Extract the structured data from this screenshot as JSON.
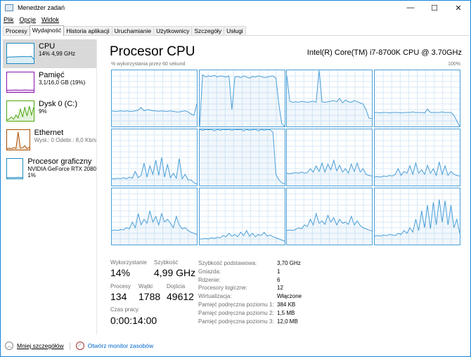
{
  "window": {
    "title": "Menedżer zadań",
    "minimize": "—",
    "maximize": "☐",
    "close": "✕"
  },
  "menu": [
    "Plik",
    "Opcje",
    "Widok"
  ],
  "tabs": [
    "Procesy",
    "Wydajność",
    "Historia aplikacji",
    "Uruchamianie",
    "Użytkownicy",
    "Szczegóły",
    "Usługi"
  ],
  "active_tab": 1,
  "sidebar": [
    {
      "name": "CPU",
      "sub": "14% 4,99 GHz",
      "color": "#1e8bc3",
      "sel": true
    },
    {
      "name": "Pamięć",
      "sub": "3,1/16,0 GB (19%)",
      "color": "#8b12ae"
    },
    {
      "name": "Dysk 0 (C:)",
      "sub": "9%",
      "color": "#4da60c"
    },
    {
      "name": "Ethernet",
      "sub": "Wysł.: 0 Odebr.: 8,0 Kb/s",
      "color": "#a74f01"
    },
    {
      "name": "Procesor graficzny",
      "sub": "NVIDIA GeForce RTX 2080",
      "sub2": "1%",
      "color": "#1e8bc3"
    }
  ],
  "main": {
    "title": "Procesor CPU",
    "model": "Intel(R) Core(TM) i7-8700K CPU @ 3.70GHz",
    "axis_left": "% wykorzystania przez 60 sekund",
    "axis_right": "100%",
    "accent": "#4a9fd8"
  },
  "cores": [
    [
      28,
      27,
      27,
      28,
      27,
      28,
      27,
      27,
      28,
      29,
      34,
      28,
      30,
      29,
      28,
      28,
      27,
      28,
      27,
      27,
      28,
      27,
      26,
      26,
      27,
      28,
      26,
      22,
      20,
      40
    ],
    [
      0,
      92,
      88,
      90,
      89,
      91,
      88,
      90,
      89,
      88,
      90,
      30,
      88,
      89,
      87,
      90,
      88,
      86,
      89,
      88,
      90,
      89,
      87,
      88,
      89,
      90,
      86,
      40,
      5,
      0
    ],
    [
      90,
      45,
      43,
      44,
      43,
      45,
      44,
      43,
      44,
      45,
      43,
      100,
      44,
      43,
      44,
      45,
      46,
      44,
      50,
      42,
      47,
      44,
      43,
      46,
      44,
      42,
      40,
      30,
      15,
      14
    ],
    [
      25,
      25,
      24,
      25,
      25,
      24,
      25,
      25,
      25,
      24,
      25,
      25,
      25,
      26,
      25,
      25,
      25,
      24,
      31,
      25,
      25,
      25,
      25,
      26,
      25,
      25,
      25,
      20,
      10,
      0
    ],
    [
      12,
      12,
      13,
      12,
      14,
      12,
      15,
      13,
      25,
      14,
      18,
      40,
      15,
      35,
      20,
      45,
      18,
      50,
      15,
      38,
      14,
      22,
      13,
      48,
      12,
      20,
      10,
      10,
      5,
      3
    ],
    [
      100,
      98,
      100,
      99,
      100,
      97,
      100,
      98,
      100,
      99,
      100,
      98,
      100,
      99,
      100,
      97,
      100,
      98,
      99,
      100,
      97,
      100,
      98,
      100,
      99,
      95,
      20,
      10,
      5,
      3
    ],
    [
      22,
      21,
      22,
      23,
      22,
      24,
      22,
      23,
      30,
      24,
      35,
      25,
      40,
      24,
      38,
      28,
      45,
      26,
      36,
      24,
      30,
      22,
      38,
      25,
      40,
      24,
      30,
      20,
      18,
      17
    ],
    [
      15,
      16,
      15,
      17,
      16,
      18,
      17,
      20,
      30,
      18,
      25,
      22,
      35,
      20,
      40,
      22,
      28,
      20,
      36,
      22,
      30,
      18,
      42,
      20,
      35,
      18,
      25,
      20,
      18,
      17
    ],
    [
      25,
      26,
      25,
      27,
      26,
      30,
      28,
      40,
      30,
      55,
      35,
      45,
      38,
      60,
      40,
      50,
      35,
      55,
      40,
      45,
      38,
      30,
      50,
      35,
      28,
      30,
      25,
      22,
      20,
      18
    ],
    [
      10,
      10,
      11,
      10,
      12,
      11,
      13,
      12,
      16,
      14,
      20,
      15,
      18,
      14,
      22,
      16,
      25,
      15,
      20,
      14,
      18,
      16,
      22,
      15,
      17,
      14,
      12,
      10,
      8,
      6
    ],
    [
      25,
      26,
      25,
      27,
      30,
      28,
      35,
      32,
      45,
      35,
      55,
      38,
      42,
      36,
      52,
      40,
      48,
      35,
      45,
      38,
      40,
      36,
      50,
      35,
      42,
      34,
      30,
      28,
      26,
      24
    ],
    [
      15,
      16,
      15,
      17,
      16,
      18,
      17,
      16,
      20,
      18,
      25,
      20,
      30,
      22,
      45,
      25,
      60,
      30,
      70,
      28,
      75,
      35,
      80,
      40,
      78,
      35,
      70,
      30,
      45,
      20
    ]
  ],
  "stats": {
    "usage_label": "Wykorzystanie",
    "usage": "14%",
    "speed_label": "Szybkość",
    "speed": "4,99 GHz",
    "proc_label": "Procesy",
    "proc": "134",
    "threads_label": "Wątki",
    "threads": "1788",
    "handles_label": "Dojścia",
    "handles": "49612",
    "uptime_label": "Czas pracy",
    "uptime": "0:00:14:00"
  },
  "specs": [
    [
      "Szybkość podstawowa:",
      "3,70 GHz"
    ],
    [
      "Gniazda:",
      "1"
    ],
    [
      "Rdzenie:",
      "6"
    ],
    [
      "Procesory logiczne:",
      "12"
    ],
    [
      "Wirtualizacja:",
      "Włączone"
    ],
    [
      "Pamięć podręczna poziomu 1:",
      "384 KB"
    ],
    [
      "Pamięć podręczna poziomu 2:",
      "1,5 MB"
    ],
    [
      "Pamięć podręczna poziomu 3:",
      "12,0 MB"
    ]
  ],
  "footer": {
    "less": "Mniej szczegółów",
    "monitor": "Otwórz monitor zasobów"
  }
}
